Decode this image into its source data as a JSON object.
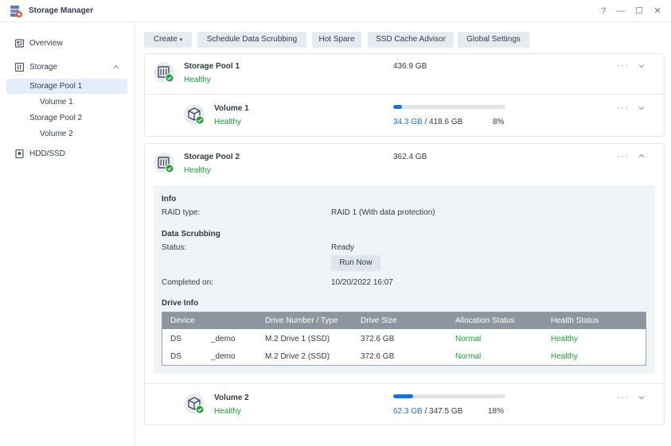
{
  "window": {
    "title": "Storage Manager",
    "help": "?",
    "minimize": "—",
    "maximize": "☐",
    "close": "✕"
  },
  "sidebar": {
    "overview": "Overview",
    "storage": "Storage",
    "pool1": "Storage Pool 1",
    "volume1": "Volume 1",
    "pool2": "Storage Pool 2",
    "volume2": "Volume 2",
    "hdd": "HDD/SSD"
  },
  "toolbar": {
    "create": "Create",
    "create_caret": "▾",
    "scrub": "Schedule Data Scrubbing",
    "hotspare": "Hot Spare",
    "ssdcache": "SSD Cache Advisor",
    "global": "Global Settings"
  },
  "pool1": {
    "name": "Storage Pool 1",
    "status": "Healthy",
    "size": "436.9 GB"
  },
  "volume1": {
    "name": "Volume 1",
    "status": "Healthy",
    "used": "34.3 GB",
    "sep": " / ",
    "total": "418.6 GB",
    "percent": "8%",
    "fill": 0.08
  },
  "pool2": {
    "name": "Storage Pool 2",
    "status": "Healthy",
    "size": "362.4 GB"
  },
  "detail": {
    "info_heading": "Info",
    "raid_label": "RAID type:",
    "raid_value": "RAID 1 (With data protection)",
    "scrub_heading": "Data Scrubbing",
    "status_label": "Status:",
    "status_value": "Ready",
    "run_now": "Run Now",
    "completed_label": "Completed on:",
    "completed_value": "10/20/2022 16:07",
    "drive_heading": "Drive Info"
  },
  "drives": {
    "headers": [
      "Device",
      "Drive Number / Type",
      "Drive Size",
      "Allocation Status",
      "Health Status"
    ],
    "rows": [
      {
        "device": "DS",
        "device_suffix": "_demo",
        "number": "M.2 Drive 1 (SSD)",
        "size": "372.6 GB",
        "allocation": "Normal",
        "health": "Healthy"
      },
      {
        "device": "DS",
        "device_suffix": "_demo",
        "number": "M.2 Drive 2 (SSD)",
        "size": "372.6 GB",
        "allocation": "Normal",
        "health": "Healthy"
      }
    ]
  },
  "volume2": {
    "name": "Volume 2",
    "status": "Healthy",
    "used": "62.3 GB",
    "sep": " / ",
    "total": "347.5 GB",
    "percent": "18%",
    "fill": 0.18
  },
  "more": "···",
  "colors": {
    "accent": "#1e6fdc",
    "healthy": "#1e9d3a",
    "table_header": "#8d969f",
    "detail_bg": "#f0f4f8"
  },
  "icons": [
    "storage-manager-app-icon",
    "overview-icon",
    "storage-icon",
    "hdd-icon",
    "pool-icon",
    "volume-cube-icon",
    "check-badge-icon",
    "more-icon",
    "chevron-down-icon",
    "chevron-up-icon"
  ]
}
